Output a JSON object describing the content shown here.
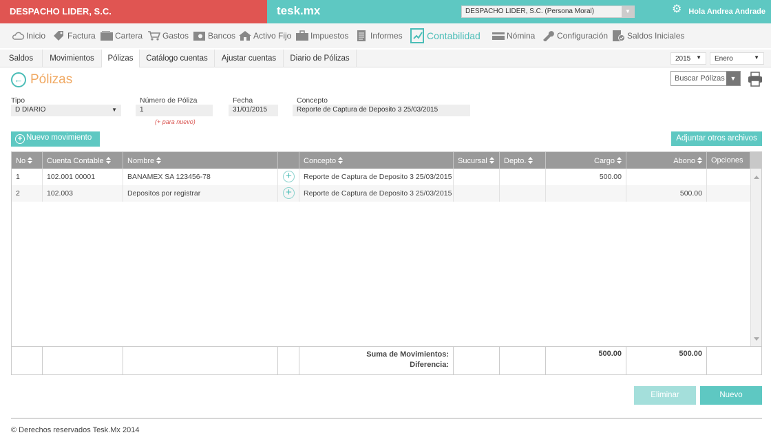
{
  "header": {
    "company": "DESPACHO LIDER, S.C.",
    "app_name": "tesk.mx",
    "company_select": "DESPACHO LIDER, S.C. (Persona Moral)",
    "greeting": "Hola Andrea Andrade"
  },
  "nav": [
    {
      "label": "Inicio",
      "icon": "cloud-icon"
    },
    {
      "label": "Factura",
      "icon": "tag-icon"
    },
    {
      "label": "Cartera",
      "icon": "wallet-icon"
    },
    {
      "label": "Gastos",
      "icon": "cart-icon"
    },
    {
      "label": "Bancos",
      "icon": "safe-icon"
    },
    {
      "label": "Activo Fijo",
      "icon": "house-icon"
    },
    {
      "label": "Impuestos",
      "icon": "briefcase-icon"
    },
    {
      "label": "Informes",
      "icon": "document-icon"
    },
    {
      "label": "Contabilidad",
      "icon": "chart-icon"
    },
    {
      "label": "Nómina",
      "icon": "card-icon"
    },
    {
      "label": "Configuración",
      "icon": "wrench-icon"
    },
    {
      "label": "Saldos Iniciales",
      "icon": "checklist-icon"
    }
  ],
  "subnav": {
    "tabs": [
      "Saldos",
      "Movimientos",
      "Pólizas",
      "Catálogo cuentas",
      "Ajustar cuentas",
      "Diario de Pólizas"
    ],
    "year": "2015",
    "month": "Enero"
  },
  "page": {
    "title": "Pólizas",
    "search_label": "Buscar Pólizas"
  },
  "form": {
    "tipo_label": "Tipo",
    "tipo_value": "D DIARIO",
    "numero_label": "Número de Póliza",
    "numero_value": "1",
    "numero_hint": "(+ para nuevo)",
    "fecha_label": "Fecha",
    "fecha_value": "31/01/2015",
    "concepto_label": "Concepto",
    "concepto_value": "Reporte de Captura de Deposito 3 25/03/2015"
  },
  "buttons": {
    "new_movement": "Nuevo movimiento",
    "attach": "Adjuntar otros archivos",
    "delete": "Eliminar",
    "new": "Nuevo"
  },
  "table": {
    "headers": {
      "no": "No",
      "cuenta": "Cuenta Contable",
      "nombre": "Nombre",
      "concepto": "Concepto",
      "sucursal": "Sucursal",
      "depto": "Depto.",
      "cargo": "Cargo",
      "abono": "Abono",
      "opciones": "Opciones"
    },
    "rows": [
      {
        "no": "1",
        "cuenta": "102.001 00001",
        "nombre": "BANAMEX SA 123456-78",
        "concepto": "Reporte de Captura de Deposito 3 25/03/2015",
        "sucursal": "",
        "depto": "",
        "cargo": "500.00",
        "abono": ""
      },
      {
        "no": "2",
        "cuenta": "102.003",
        "nombre": "Depositos por registrar",
        "concepto": "Reporte de Captura de Deposito 3 25/03/2015",
        "sucursal": "",
        "depto": "",
        "cargo": "",
        "abono": "500.00"
      }
    ],
    "footer": {
      "suma_label": "Suma de Movimientos:",
      "diferencia_label": "Diferencia:",
      "total_cargo": "500.00",
      "total_abono": "500.00"
    }
  },
  "footer": {
    "copyright": "© Derechos reservados Tesk.Mx 2014"
  },
  "colors": {
    "brand_red": "#e05552",
    "brand_teal": "#5ec8c2",
    "title_orange": "#f0a963",
    "header_gray": "#9a9a9a"
  }
}
